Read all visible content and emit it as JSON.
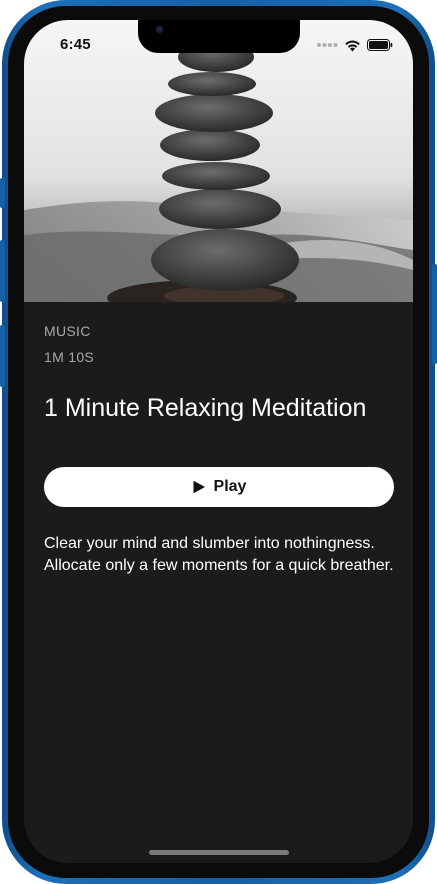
{
  "status_bar": {
    "time": "6:45",
    "icons": [
      "cellular-dots-icon",
      "wifi-icon",
      "battery-icon"
    ]
  },
  "hero_image": {
    "subject": "stacked stones on a misty beach"
  },
  "track": {
    "category": "MUSIC",
    "duration": "1M 10S",
    "title": "1 Minute Relaxing Meditation",
    "play_label": "Play",
    "description": "Clear your mind and slumber into nothingness. Allocate only a few moments for a quick breather."
  },
  "colors": {
    "background": "#1c1b1a",
    "frame": "#1561a6",
    "button": "#ffffff",
    "muted_text": "#a8a8a8"
  }
}
